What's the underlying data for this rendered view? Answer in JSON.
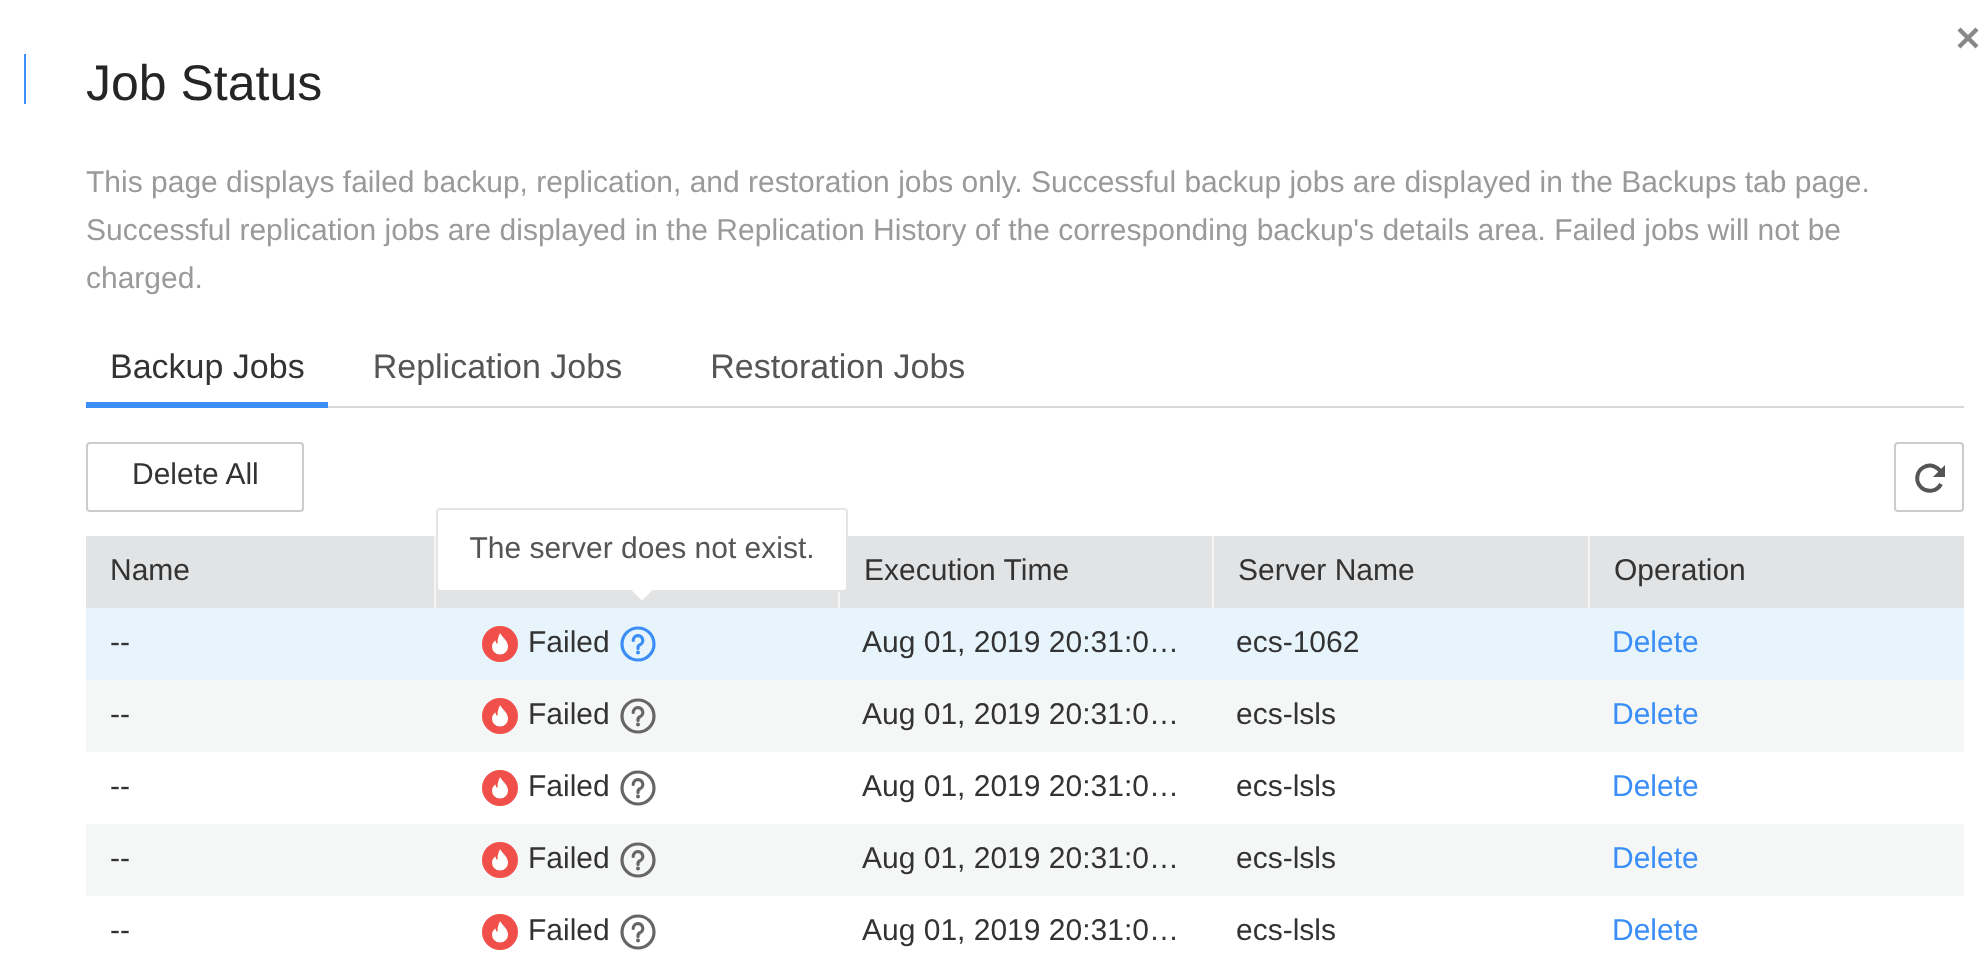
{
  "dialog": {
    "title": "Job Status",
    "description": "This page displays failed backup, replication, and restoration jobs only. Successful backup jobs are displayed in the Backups tab page. Successful replication jobs are displayed in the Replication History of the corresponding backup's details area. Failed jobs will not be charged."
  },
  "tabs": [
    {
      "label": "Backup Jobs",
      "selected": true
    },
    {
      "label": "Replication Jobs",
      "selected": false
    },
    {
      "label": "Restoration Jobs",
      "selected": false
    }
  ],
  "toolbar": {
    "delete_all": "Delete All"
  },
  "table": {
    "columns": {
      "column_1": "Name",
      "column_3": "Execution Time",
      "column_4": "Server Name",
      "column_5": "Operation"
    },
    "tooltip": "The server does not exist.",
    "rows": [
      {
        "name": "--",
        "status": "Failed",
        "execution_time": "Aug 01, 2019 20:31:0…",
        "server_name": "ecs-1062",
        "operation": "Delete",
        "highlighted": true
      },
      {
        "name": "--",
        "status": "Failed",
        "execution_time": "Aug 01, 2019 20:31:0…",
        "server_name": "ecs-lsls",
        "operation": "Delete",
        "highlighted": false
      },
      {
        "name": "--",
        "status": "Failed",
        "execution_time": "Aug 01, 2019 20:31:0…",
        "server_name": "ecs-lsls",
        "operation": "Delete",
        "highlighted": false
      },
      {
        "name": "--",
        "status": "Failed",
        "execution_time": "Aug 01, 2019 20:31:0…",
        "server_name": "ecs-lsls",
        "operation": "Delete",
        "highlighted": false
      },
      {
        "name": "--",
        "status": "Failed",
        "execution_time": "Aug 01, 2019 20:31:0…",
        "server_name": "ecs-lsls",
        "operation": "Delete",
        "highlighted": false
      }
    ]
  }
}
